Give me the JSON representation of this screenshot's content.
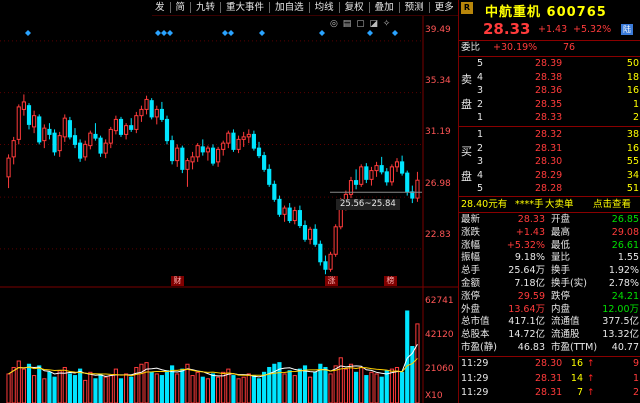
{
  "toolbar": {
    "items": [
      "发",
      "简",
      "九转",
      "重大事件",
      "加自选",
      "均线",
      "复权",
      "叠加",
      "预测",
      "更多"
    ],
    "icons": [
      "gear-icon",
      "toggle-icon"
    ]
  },
  "chart": {
    "price_ticks": [
      "39.49",
      "35.34",
      "31.19",
      "26.98",
      "22.83"
    ],
    "volume_ticks": [
      "62741",
      "42120",
      "21060"
    ],
    "volume_unit": "X10",
    "range_label": "25.56~25.84",
    "event_markers": [
      "财",
      "涨",
      "榜"
    ],
    "colors": {
      "up": "#ff3b3b",
      "down": "#00e5ff",
      "bg": "#000000",
      "grid": "#5a0000"
    }
  },
  "chart_data": {
    "type": "candlestick",
    "ylim": [
      20.5,
      41.0
    ],
    "candles": [
      [
        28.6,
        30.4,
        27.7,
        30.1
      ],
      [
        30.2,
        31.8,
        29.6,
        31.5
      ],
      [
        31.6,
        34.4,
        31.2,
        34.2
      ],
      [
        34.0,
        35.2,
        33.5,
        34.6
      ],
      [
        34.3,
        34.5,
        32.4,
        32.8
      ],
      [
        32.6,
        33.9,
        32.1,
        33.5
      ],
      [
        33.4,
        33.6,
        31.2,
        31.4
      ],
      [
        31.5,
        32.8,
        30.9,
        32.5
      ],
      [
        32.4,
        32.9,
        31.6,
        32.0
      ],
      [
        32.1,
        32.4,
        30.3,
        30.6
      ],
      [
        30.7,
        32.2,
        30.2,
        31.9
      ],
      [
        31.8,
        33.6,
        31.4,
        33.3
      ],
      [
        33.1,
        33.4,
        31.6,
        31.8
      ],
      [
        31.9,
        32.5,
        30.9,
        31.2
      ],
      [
        31.3,
        31.6,
        29.8,
        30.1
      ],
      [
        30.2,
        31.5,
        29.9,
        31.2
      ],
      [
        31.1,
        32.3,
        30.8,
        32.1
      ],
      [
        32.0,
        32.9,
        31.5,
        31.7
      ],
      [
        31.7,
        31.9,
        30.2,
        30.5
      ],
      [
        30.5,
        31.6,
        30.1,
        31.3
      ],
      [
        31.3,
        32.6,
        30.9,
        32.4
      ],
      [
        32.3,
        33.5,
        32.0,
        33.2
      ],
      [
        33.2,
        33.4,
        31.8,
        32.0
      ],
      [
        32.0,
        32.9,
        31.6,
        32.7
      ],
      [
        32.7,
        33.3,
        32.2,
        32.4
      ],
      [
        32.4,
        33.8,
        32.1,
        33.5
      ],
      [
        33.5,
        34.3,
        33.0,
        34.0
      ],
      [
        34.0,
        35.1,
        33.6,
        34.8
      ],
      [
        34.7,
        34.9,
        33.2,
        33.4
      ],
      [
        33.4,
        34.3,
        32.8,
        34.0
      ],
      [
        34.0,
        34.6,
        33.0,
        33.2
      ],
      [
        33.2,
        33.5,
        31.2,
        31.5
      ],
      [
        31.5,
        31.9,
        29.6,
        29.9
      ],
      [
        29.9,
        31.2,
        29.4,
        30.9
      ],
      [
        30.9,
        31.1,
        28.9,
        29.2
      ],
      [
        29.2,
        30.1,
        27.8,
        29.9
      ],
      [
        29.8,
        30.6,
        29.2,
        30.2
      ],
      [
        30.2,
        31.3,
        29.8,
        31.1
      ],
      [
        31.0,
        31.6,
        30.3,
        30.6
      ],
      [
        30.6,
        31.1,
        29.9,
        30.9
      ],
      [
        30.9,
        31.2,
        29.5,
        29.7
      ],
      [
        29.8,
        31.0,
        29.4,
        30.8
      ],
      [
        30.8,
        31.5,
        30.3,
        31.3
      ],
      [
        31.3,
        32.3,
        30.9,
        32.1
      ],
      [
        32.1,
        32.4,
        30.6,
        30.8
      ],
      [
        30.8,
        31.9,
        30.5,
        31.6
      ],
      [
        31.6,
        32.2,
        31.0,
        31.8
      ],
      [
        31.8,
        32.4,
        31.3,
        32.0
      ],
      [
        32.0,
        32.3,
        30.7,
        30.9
      ],
      [
        30.9,
        31.4,
        30.1,
        30.3
      ],
      [
        30.3,
        30.6,
        29.0,
        29.2
      ],
      [
        29.2,
        29.6,
        27.8,
        28.0
      ],
      [
        28.0,
        28.3,
        26.6,
        26.8
      ],
      [
        26.8,
        27.1,
        25.4,
        25.6
      ],
      [
        25.6,
        26.3,
        25.0,
        26.1
      ],
      [
        26.1,
        26.5,
        24.9,
        25.1
      ],
      [
        25.1,
        26.2,
        24.8,
        25.9
      ],
      [
        25.9,
        26.3,
        24.5,
        24.7
      ],
      [
        24.7,
        25.1,
        23.4,
        23.6
      ],
      [
        23.6,
        24.6,
        23.2,
        24.4
      ],
      [
        24.4,
        24.8,
        23.0,
        23.2
      ],
      [
        23.2,
        23.5,
        21.5,
        21.8
      ],
      [
        21.8,
        22.3,
        20.8,
        21.2
      ],
      [
        21.2,
        22.6,
        21.0,
        22.4
      ],
      [
        22.4,
        24.8,
        22.2,
        24.6
      ],
      [
        24.6,
        26.9,
        24.4,
        26.7
      ],
      [
        26.7,
        27.5,
        25.9,
        27.2
      ],
      [
        27.2,
        28.6,
        26.9,
        28.3
      ],
      [
        28.3,
        29.2,
        27.6,
        28.0
      ],
      [
        28.0,
        29.6,
        27.8,
        29.4
      ],
      [
        29.4,
        29.7,
        28.1,
        28.4
      ],
      [
        28.4,
        29.4,
        27.9,
        29.1
      ],
      [
        29.1,
        29.8,
        28.6,
        29.5
      ],
      [
        29.5,
        30.2,
        28.8,
        29.0
      ],
      [
        29.0,
        29.3,
        27.9,
        28.2
      ],
      [
        28.2,
        29.6,
        27.9,
        29.4
      ],
      [
        29.4,
        30.1,
        29.0,
        29.8
      ],
      [
        29.8,
        30.3,
        28.7,
        28.9
      ],
      [
        28.9,
        29.1,
        27.1,
        27.4
      ],
      [
        27.4,
        27.9,
        26.5,
        26.9
      ],
      [
        26.9,
        29.0,
        26.6,
        28.33
      ]
    ],
    "volume_ylim": [
      0,
      70000
    ],
    "volumes": [
      18000,
      22000,
      26000,
      21000,
      24000,
      17000,
      23000,
      15000,
      19000,
      16000,
      20000,
      22000,
      18000,
      17000,
      21000,
      14000,
      19000,
      15000,
      18000,
      16000,
      17000,
      21000,
      15000,
      18000,
      16000,
      22000,
      24000,
      25000,
      19000,
      18000,
      17000,
      20000,
      23000,
      18000,
      21000,
      24000,
      17000,
      19000,
      16000,
      15000,
      18000,
      16000,
      19000,
      21000,
      17000,
      15000,
      16000,
      18000,
      17000,
      15000,
      19000,
      22000,
      24000,
      25000,
      18000,
      20000,
      17000,
      21000,
      23000,
      16000,
      19000,
      24000,
      22000,
      18000,
      23000,
      28000,
      21000,
      24000,
      19000,
      22000,
      17000,
      19000,
      18000,
      16000,
      20000,
      21000,
      22000,
      19000,
      57000,
      35000,
      49000
    ]
  },
  "quote": {
    "name": "中航重机",
    "code": "600765",
    "price": "28.33",
    "change": "+1.43",
    "change_pct": "+5.32%",
    "tag_r": "R",
    "tag_lu": "陆",
    "weibi_label": "委比",
    "weibi_val": "+30.19%",
    "weibi_cnt": "76",
    "sell_label": [
      "卖",
      "盘"
    ],
    "buy_label": [
      "买",
      "盘"
    ],
    "sell": [
      {
        "n": "5",
        "p": "28.39",
        "v": "50"
      },
      {
        "n": "4",
        "p": "28.38",
        "v": "18"
      },
      {
        "n": "3",
        "p": "28.36",
        "v": "16"
      },
      {
        "n": "2",
        "p": "28.35",
        "v": "1"
      },
      {
        "n": "1",
        "p": "28.33",
        "v": "2"
      }
    ],
    "buy": [
      {
        "n": "1",
        "p": "28.32",
        "v": "38"
      },
      {
        "n": "2",
        "p": "28.31",
        "v": "16"
      },
      {
        "n": "3",
        "p": "28.30",
        "v": "55"
      },
      {
        "n": "4",
        "p": "28.29",
        "v": "34"
      },
      {
        "n": "5",
        "p": "28.28",
        "v": "51"
      }
    ],
    "bar": {
      "a": "28.40元有",
      "b": "****手",
      "c": "大卖单",
      "d": "点击查看"
    },
    "stats": [
      [
        "最新",
        "28.33",
        "开盘",
        "26.85"
      ],
      [
        "涨跌",
        "+1.43",
        "最高",
        "29.08"
      ],
      [
        "涨幅",
        "+5.32%",
        "最低",
        "26.61"
      ],
      [
        "振幅",
        "9.18%",
        "量比",
        "1.55"
      ],
      [
        "总手",
        "25.64万",
        "换手",
        "1.92%"
      ],
      [
        "金额",
        "7.18亿",
        "换手(实)",
        "2.78%"
      ],
      [
        "涨停",
        "29.59",
        "跌停",
        "24.21"
      ],
      [
        "外盘",
        "13.64万",
        "内盘",
        "12.00万"
      ],
      [
        "总市值",
        "417.1亿",
        "流通值",
        "377.5亿"
      ],
      [
        "总股本",
        "14.72亿",
        "流通股",
        "13.32亿"
      ],
      [
        "市盈(静)",
        "46.83",
        "市盈(TTM)",
        "40.77"
      ]
    ],
    "ticks": [
      {
        "t": "11:29",
        "p": "28.30",
        "v": "16",
        "n": "9"
      },
      {
        "t": "11:29",
        "p": "28.31",
        "v": "14",
        "n": "1"
      },
      {
        "t": "11:29",
        "p": "28.31",
        "v": "7",
        "n": "2"
      }
    ]
  }
}
